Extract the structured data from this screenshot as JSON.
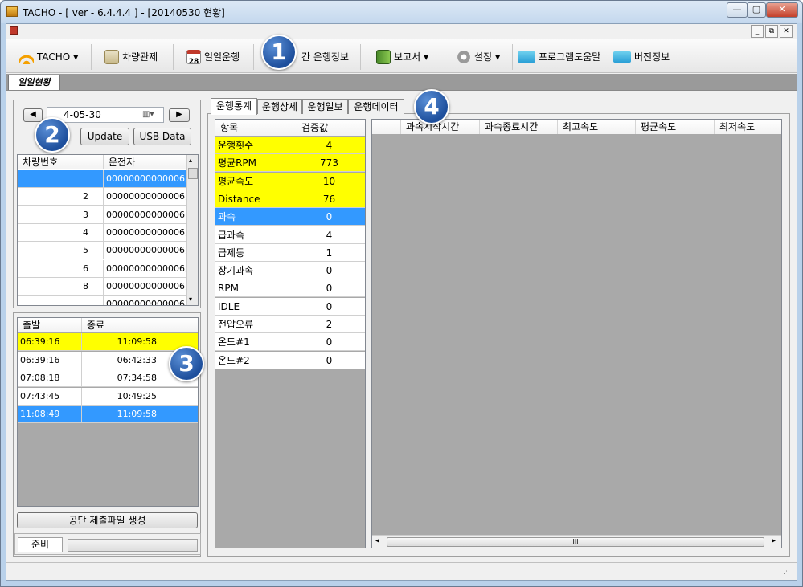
{
  "window": {
    "title": "TACHO -  [ ver - 6.4.4.4 ] - [20140530  현황]",
    "min": "—",
    "max": "▢",
    "close": "✕"
  },
  "mdi": {
    "min": "_",
    "restore": "⧉",
    "close": "✕"
  },
  "toolbar": {
    "tacho": "TACHO",
    "vehicle_control": "차량관제",
    "daily": "일일운행",
    "daily_icon_num": "28",
    "period_info": "간 운행정보",
    "report": "보고서",
    "settings": "설정",
    "help": "프로그램도움말",
    "version": "버전정보"
  },
  "mdi_tab": "일일현황",
  "left": {
    "date": "2014-05-30",
    "date_visible": "4-05-30",
    "prev": "◀",
    "next": "▶",
    "update": "Update",
    "usb": "USB Data",
    "vehicle_headers": [
      "차량번호",
      "운전자"
    ],
    "vehicles": [
      {
        "no": "",
        "driver": "00000000000006,..."
      },
      {
        "no": "2",
        "driver": "00000000000006,..."
      },
      {
        "no": "3",
        "driver": "00000000000006,..."
      },
      {
        "no": "4",
        "driver": "00000000000006,..."
      },
      {
        "no": "5",
        "driver": "00000000000006,..."
      },
      {
        "no": "6",
        "driver": "00000000000006,..."
      },
      {
        "no": "8",
        "driver": "00000000000006,..."
      },
      {
        "no": "",
        "driver": "00000000000006..."
      }
    ],
    "trip_headers": [
      "출발",
      "종료"
    ],
    "trips": [
      {
        "start": "06:39:16",
        "end": "11:09:58"
      },
      {
        "start": "06:39:16",
        "end": "06:42:33"
      },
      {
        "start": "07:08:18",
        "end": "07:34:58"
      },
      {
        "start": "07:43:45",
        "end": "10:49:25"
      },
      {
        "start": "11:08:49",
        "end": "11:09:58"
      }
    ],
    "generate": "공단 제출파일 생성",
    "status": "준비"
  },
  "tabs": [
    "운행통계",
    "운행상세",
    "운행일보",
    "운행데이터"
  ],
  "stats": {
    "headers": [
      "항목",
      "검증값"
    ],
    "rows": [
      {
        "item": "운행횟수",
        "val": "4"
      },
      {
        "item": "평균RPM",
        "val": "773"
      },
      {
        "item": "평균속도",
        "val": "10"
      },
      {
        "item": "Distance",
        "val": "76"
      },
      {
        "item": "과속",
        "val": "0"
      },
      {
        "item": "급과속",
        "val": "4"
      },
      {
        "item": "급제동",
        "val": "1"
      },
      {
        "item": "장기과속",
        "val": "0"
      },
      {
        "item": "RPM",
        "val": "0"
      },
      {
        "item": "IDLE",
        "val": "0"
      },
      {
        "item": "전압오류",
        "val": "2"
      },
      {
        "item": "온도#1",
        "val": "0"
      },
      {
        "item": "온도#2",
        "val": "0"
      }
    ]
  },
  "detail_headers": [
    "",
    "과속시작시간",
    "과속종료시간",
    "최고속도",
    "평균속도",
    "최저속도"
  ],
  "scroll": {
    "left": "◂",
    "right": "▸",
    "thumb": "III",
    "up": "▴",
    "down": "▾"
  },
  "badges": [
    "1",
    "2",
    "3",
    "4"
  ],
  "colors": {
    "highlight": "#ffff00",
    "selection": "#3399ff",
    "badge": "#2a62b4"
  }
}
